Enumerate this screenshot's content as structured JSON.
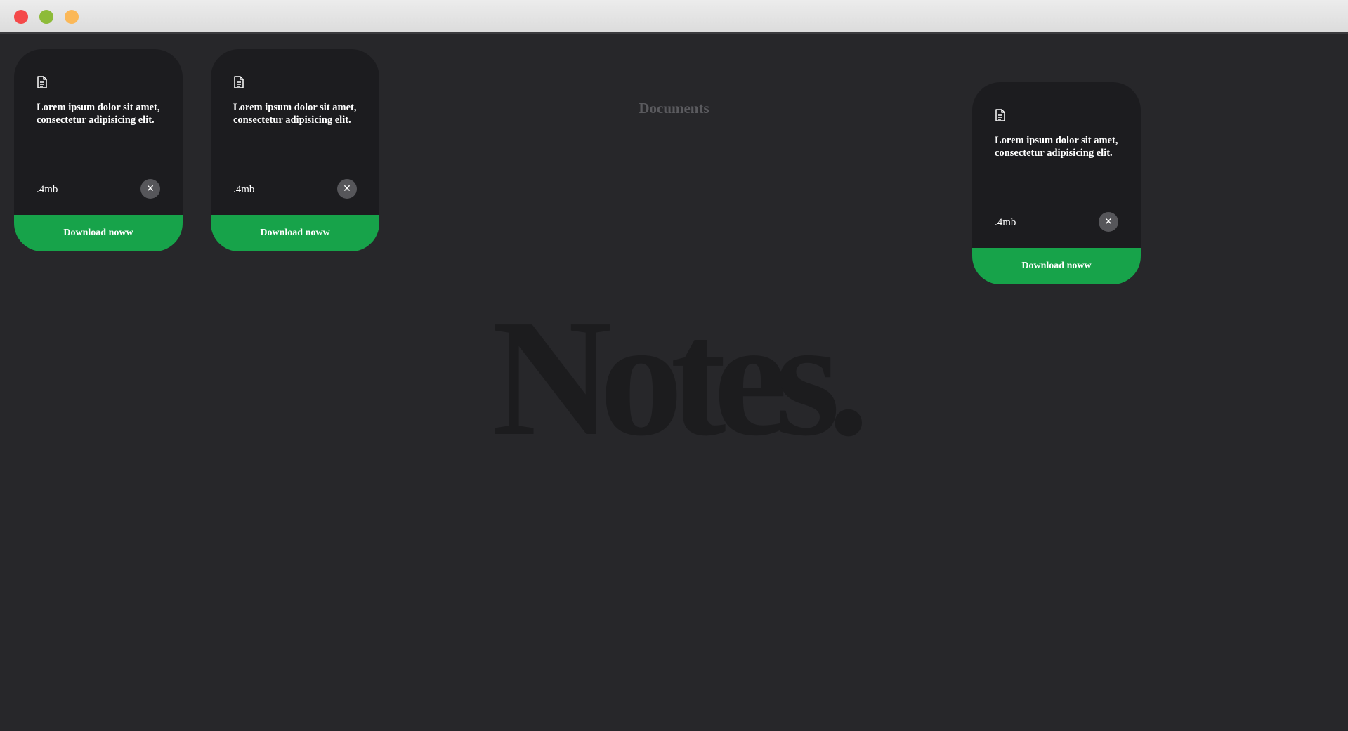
{
  "window": {
    "controls": [
      "close",
      "minimize",
      "zoom"
    ]
  },
  "section": {
    "title": "Documents"
  },
  "watermark": {
    "text": "Notes."
  },
  "cards": [
    {
      "icon": "document-icon",
      "description": "Lorem ipsum dolor sit amet, consectetur adipisicing elit.",
      "size": ".4mb",
      "close_label": "✕",
      "download_label": "Download noww"
    },
    {
      "icon": "document-icon",
      "description": "Lorem ipsum dolor sit amet, consectetur adipisicing elit.",
      "size": ".4mb",
      "close_label": "✕",
      "download_label": "Download noww"
    },
    {
      "icon": "document-icon",
      "description": "Lorem ipsum dolor sit amet, consectetur adipisicing elit.",
      "size": ".4mb",
      "close_label": "✕",
      "download_label": "Download noww"
    }
  ],
  "colors": {
    "background": "#27272a",
    "card": "#1c1c1f",
    "accent": "#17a34a"
  }
}
